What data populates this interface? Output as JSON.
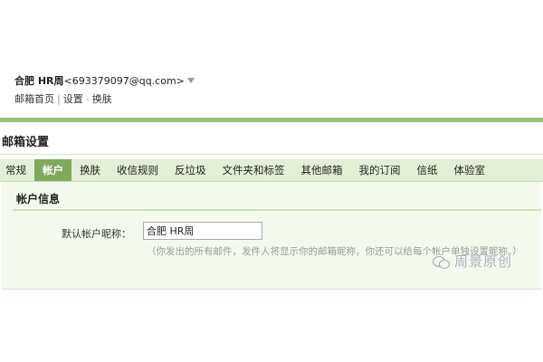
{
  "user": {
    "name": "合肥 HR周",
    "email": "<693379097@qq.com>"
  },
  "top_links": [
    "邮箱首页",
    "设置",
    "换肤"
  ],
  "page_title": "邮箱设置",
  "tabs": [
    {
      "label": "常规",
      "active": false
    },
    {
      "label": "帐户",
      "active": true
    },
    {
      "label": "换肤",
      "active": false
    },
    {
      "label": "收信规则",
      "active": false
    },
    {
      "label": "反垃圾",
      "active": false
    },
    {
      "label": "文件夹和标签",
      "active": false
    },
    {
      "label": "其他邮箱",
      "active": false
    },
    {
      "label": "我的订阅",
      "active": false
    },
    {
      "label": "信纸",
      "active": false
    },
    {
      "label": "体验室",
      "active": false
    }
  ],
  "account_info": {
    "title": "帐户信息",
    "nickname_label": "默认帐户昵称：",
    "nickname_value": "合肥 HR周",
    "hint": "（你发出的所有邮件，发件人将显示你的邮箱昵称，你还可以给每个帐户单独设置昵称。）"
  },
  "watermark": {
    "text": "周景原创",
    "icon": "wechat-icon"
  },
  "colors": {
    "accent": "#7fa95b",
    "tab_bar": "#e4efd7",
    "panel": "#f4f9ee",
    "rule": "#9bc07a"
  }
}
